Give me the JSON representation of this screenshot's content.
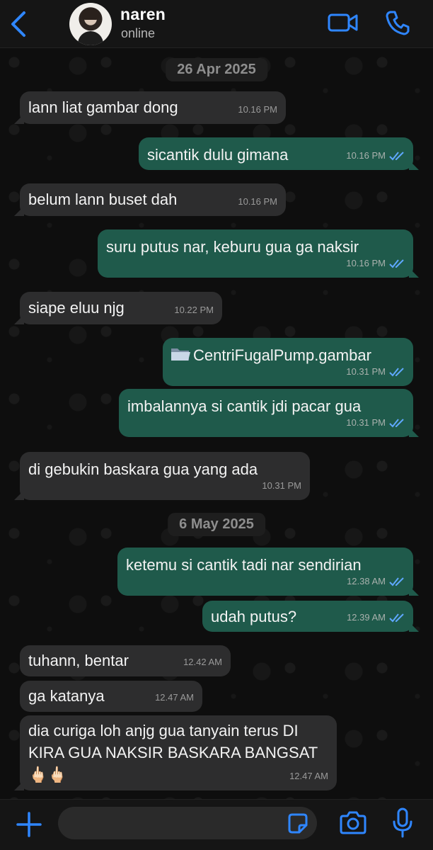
{
  "header": {
    "name": "naren",
    "status": "online"
  },
  "icons": {
    "back": "chevron-left-icon",
    "video": "video-camera-icon",
    "call": "phone-icon",
    "plus": "plus-icon",
    "sticker": "sticker-icon",
    "camera": "camera-icon",
    "mic": "microphone-icon"
  },
  "colors": {
    "accent": "#2f86ff",
    "incoming_bubble": "#2d2d2e",
    "outgoing_bubble": "#1f5a4b"
  },
  "dates": [
    "26 Apr 2025",
    "6 May 2025"
  ],
  "messages": [
    {
      "dir": "in",
      "text": "lann liat gambar dong",
      "time": "10.16 PM"
    },
    {
      "dir": "out",
      "text": "sicantik dulu gimana",
      "time": "10.16 PM"
    },
    {
      "dir": "in",
      "text": "belum lann buset dah",
      "time": "10.16 PM"
    },
    {
      "dir": "out",
      "text": "suru putus nar, keburu gua ga naksir",
      "time": "10.16 PM"
    },
    {
      "dir": "in",
      "text": "siape eluu njg",
      "time": "10.22 PM"
    },
    {
      "dir": "out",
      "text": "CentriFugalPump.gambar",
      "time": "10.31 PM",
      "icon": "folder-icon"
    },
    {
      "dir": "out",
      "text": "imbalannya si cantik jdi pacar gua",
      "time": "10.31 PM"
    },
    {
      "dir": "in",
      "text": "di gebukin baskara gua yang ada",
      "time": "10.31 PM"
    },
    {
      "dir": "out",
      "text": "ketemu si cantik tadi nar sendirian",
      "time": "12.38 AM"
    },
    {
      "dir": "out",
      "text": "udah putus?",
      "time": "12.39 AM"
    },
    {
      "dir": "in",
      "text": "tuhann, bentar",
      "time": "12.42 AM"
    },
    {
      "dir": "in",
      "text": "ga katanya",
      "time": "12.47 AM"
    },
    {
      "dir": "in",
      "text": "dia curiga loh anjg gua tanyain terus DI KIRA GUA NAKSIR BASKARA BANGSAT 🖕🏻🖕🏻",
      "time": "12.47 AM"
    }
  ],
  "composer": {
    "placeholder": ""
  }
}
